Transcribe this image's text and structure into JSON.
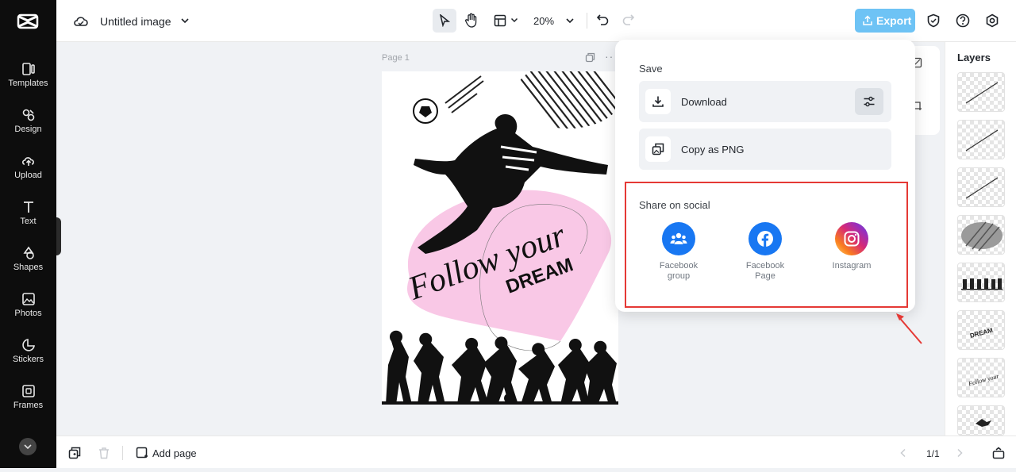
{
  "sidebar": {
    "items": [
      {
        "label": "Templates",
        "icon": "templates-icon"
      },
      {
        "label": "Design",
        "icon": "design-icon"
      },
      {
        "label": "Upload",
        "icon": "upload-icon"
      },
      {
        "label": "Text",
        "icon": "text-icon"
      },
      {
        "label": "Shapes",
        "icon": "shapes-icon"
      },
      {
        "label": "Photos",
        "icon": "photos-icon"
      },
      {
        "label": "Stickers",
        "icon": "stickers-icon"
      },
      {
        "label": "Frames",
        "icon": "frames-icon"
      }
    ]
  },
  "header": {
    "title": "Untitled image",
    "zoom": "20%",
    "export_label": "Export"
  },
  "canvas": {
    "page_label": "Page 1",
    "poster_line1": "Follow your",
    "poster_line2": "DREAM"
  },
  "layers": {
    "title": "Layers"
  },
  "bottom": {
    "add_page_label": "Add page",
    "page_count": "1/1"
  },
  "export_popup": {
    "save_label": "Save",
    "download_label": "Download",
    "copy_label": "Copy as PNG",
    "share_label": "Share on social",
    "social": [
      {
        "label": "Facebook group",
        "icon": "facebook-group-icon",
        "color": "#1877f2"
      },
      {
        "label": "Facebook Page",
        "icon": "facebook-page-icon",
        "color": "#1877f2"
      },
      {
        "label": "Instagram",
        "icon": "instagram-icon",
        "color": "#e1306c"
      }
    ]
  },
  "colors": {
    "accent": "#6ec3f5",
    "highlight": "#e53935",
    "sidebar_bg": "#0d0d0d"
  }
}
